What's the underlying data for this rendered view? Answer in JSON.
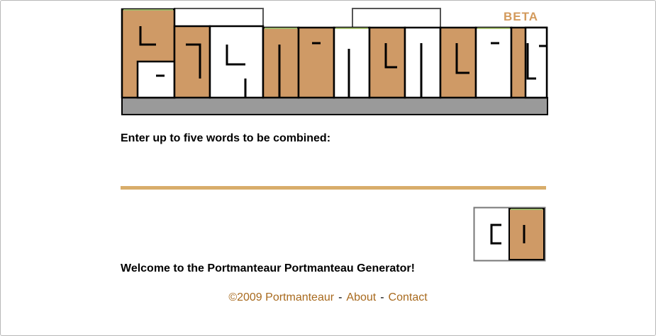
{
  "logo": {
    "alt_text": "PORTMANTEAUR",
    "badge": "BETA"
  },
  "form": {
    "prompt": "Enter up to five words to be combined:",
    "input_value": "",
    "input_placeholder": "",
    "go_button_alt": "GO"
  },
  "welcome": "Welcome to the Portmanteaur Portmanteau Generator!",
  "footer": {
    "copyright": "©2009 Portmanteaur",
    "separator": "-",
    "about": "About",
    "contact": "Contact"
  },
  "colors": {
    "brand_tan": "#cf9a66",
    "input_underline": "#d8ad6a",
    "link": "#a86a1e",
    "shadow_gray": "#9a9a9a",
    "tile_border": "#000000"
  }
}
